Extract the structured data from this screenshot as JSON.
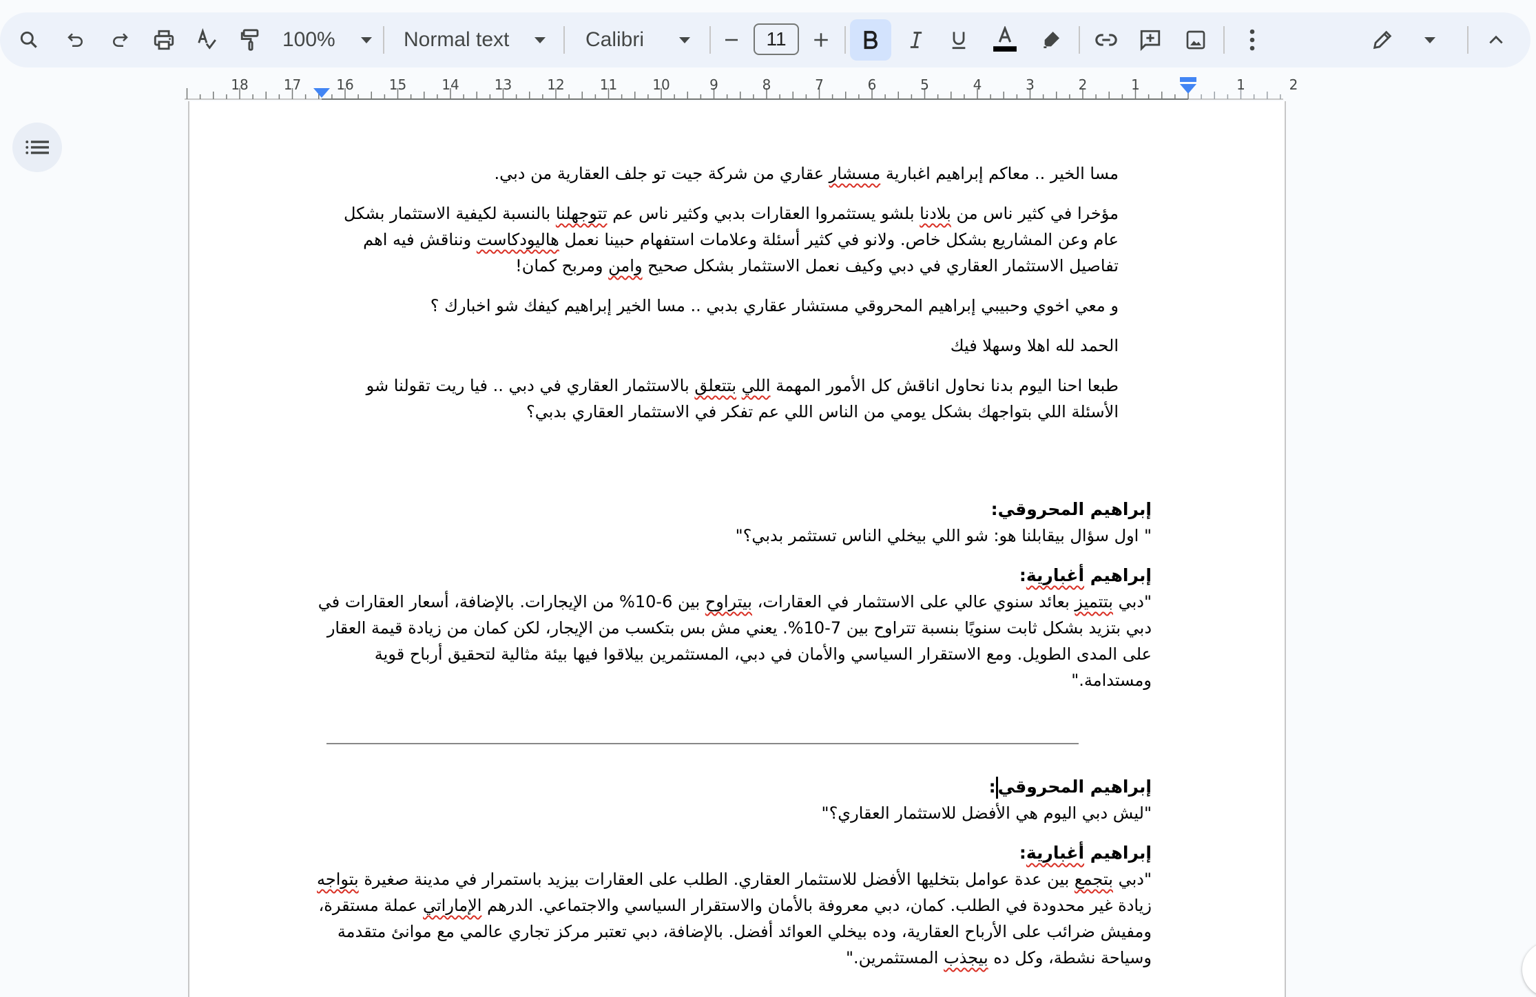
{
  "toolbar": {
    "zoom_value": "100%",
    "style_value": "Normal text",
    "font_value": "Calibri",
    "font_size": "11",
    "buttons": [
      "search",
      "undo",
      "redo",
      "print",
      "spellcheck",
      "paint-format",
      "zoom",
      "styles",
      "font",
      "decrease-font-size",
      "font-size",
      "increase-font-size",
      "bold",
      "italic",
      "underline",
      "text-color",
      "highlight",
      "insert-link",
      "add-comment",
      "insert-image",
      "more-options",
      "editing-mode",
      "hide-menus"
    ],
    "bold_active": true,
    "text_color": "#000000"
  },
  "ruler": {
    "labels_left": [
      "18",
      "17",
      "16",
      "15",
      "14",
      "13",
      "12",
      "11",
      "10",
      "9",
      "8",
      "7",
      "6",
      "5",
      "4",
      "3",
      "2",
      "1"
    ],
    "labels_right": [
      "1",
      "2"
    ]
  },
  "document": {
    "intro": [
      {
        "segments": [
          {
            "t": "مسا الخير .. معاكم إبراهيم اغبارية "
          },
          {
            "t": "مسشار",
            "sq": true
          },
          {
            "t": " عقاري من شركة جيت تو جلف العقارية من دبي."
          }
        ]
      },
      {
        "segments": [
          {
            "t": "مؤخرا في كثير ناس من "
          },
          {
            "t": "بلادنا",
            "sq": true
          },
          {
            "t": " بلشو يستثمروا العقارات بدبي وكثير ناس عم "
          },
          {
            "t": "تتوجهلنا",
            "sq": true
          },
          {
            "t": " بالنسبة لكيفية الاستثمار بشكل عام وعن المشاريع بشكل خاص. ولانو في كثير أسئلة وعلامات استفهام حبينا نعمل "
          },
          {
            "t": "هاليودكاست",
            "sq": true
          },
          {
            "t": " ونناقش فيه اهم تفاصيل الاستثمار العقاري في دبي وكيف نعمل الاستثمار بشكل صحيح "
          },
          {
            "t": "وامن",
            "sq": true
          },
          {
            "t": " ومربح كمان!"
          }
        ]
      },
      {
        "segments": [
          {
            "t": "و معي اخوي وحبيبي إبراهيم المحروقي مستشار عقاري بدبي .. مسا الخير إبراهيم كيفك شو اخبارك ؟"
          }
        ]
      },
      {
        "segments": [
          {
            "t": "الحمد لله اهلا وسهلا فيك"
          }
        ]
      },
      {
        "segments": [
          {
            "t": "طبعا احنا اليوم بدنا نحاول اناقش كل الأمور المهمة "
          },
          {
            "t": "اللي",
            "sq": true
          },
          {
            "t": " "
          },
          {
            "t": "بتتعلق",
            "sq": true
          },
          {
            "t": " بالاستثمار العقاري في دبي .. فيا ريت تقولنا شو الأسئلة اللي بتواجهك بشكل يومي من الناس اللي عم تفكر في الاستثمار العقاري بدبي؟"
          }
        ]
      }
    ],
    "qa1": {
      "speaker_q": "إبراهيم المحروقي:",
      "question": "\" اول سؤال بيقابلنا هو: شو اللي بيخلي الناس تستثمر بدبي؟\"",
      "speaker_a_first": "إبراهيم ",
      "speaker_a_last": "أغبارية",
      "speaker_a_colon": ":",
      "answer": [
        {
          "t": "\"دبي "
        },
        {
          "t": "بتتميز",
          "sq": true
        },
        {
          "t": " بعائد سنوي عالي على الاستثمار في العقارات، "
        },
        {
          "t": "بيتراوح",
          "sq": true
        },
        {
          "t": " بين 6-10% من الإيجارات. بالإضافة، أسعار العقارات في دبي بتزيد بشكل ثابت سنويًا بنسبة تتراوح بين 7-10%. يعني مش بس بتكسب من الإيجار، لكن كمان من زيادة قيمة العقار على المدى الطويل. ومع الاستقرار السياسي والأمان في دبي، المستثمرين بيلاقوا فيها بيئة مثالية لتحقيق أرباح قوية ومستدامة.\""
        }
      ]
    },
    "qa2": {
      "speaker_q": "إبراهيم المحروقي",
      "speaker_q_colon": ":",
      "question": "\"ليش دبي اليوم هي الأفضل للاستثمار العقاري؟\"",
      "speaker_a_first": "إبراهيم ",
      "speaker_a_last": "أغبارية",
      "speaker_a_colon": ":",
      "answer": [
        {
          "t": "\"دبي "
        },
        {
          "t": "بتجمع",
          "sq": true
        },
        {
          "t": " بين عدة عوامل بتخليها الأفضل للاستثمار العقاري. الطلب على العقارات بيزيد باستمرار في مدينة صغيرة "
        },
        {
          "t": "بتواجه",
          "sq": true
        },
        {
          "t": " زيادة غير محدودة في الطلب. كمان، دبي معروفة بالأمان والاستقرار السياسي والاجتماعي. الدرهم "
        },
        {
          "t": "الإماراتي",
          "sq": true
        },
        {
          "t": " عملة مستقرة، ومفيش ضرائب على الأرباح العقارية، وده بيخلي العوائد أفضل. بالإضافة، دبي تعتبر مركز تجاري عالمي مع موانئ متقدمة وسياحة نشطة، وكل ده "
        },
        {
          "t": "بيجذب",
          "sq": true
        },
        {
          "t": " المستثمرين.\""
        }
      ]
    }
  }
}
